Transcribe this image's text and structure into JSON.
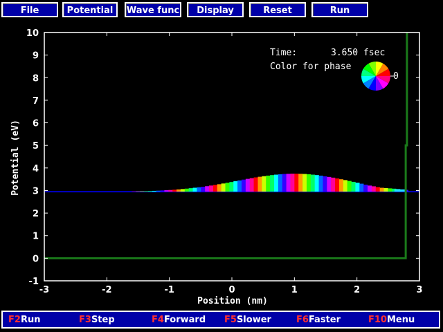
{
  "menu": [
    {
      "label": "File"
    },
    {
      "label": "Potential"
    },
    {
      "label": "Wave func"
    },
    {
      "label": "Display"
    },
    {
      "label": "Reset"
    },
    {
      "label": "Run"
    }
  ],
  "annotation": {
    "time_label": "Time:",
    "time_value": "3.650 fsec",
    "color_label": "Color for phase",
    "phase_zero": "0"
  },
  "chart_data": {
    "type": "area",
    "title": "",
    "xlabel": "Position (nm)",
    "ylabel": "Potential (eV)",
    "xlim": [
      -3,
      3
    ],
    "ylim": [
      -1,
      10
    ],
    "xticks": [
      -3,
      -2,
      -1,
      0,
      1,
      2,
      3
    ],
    "yticks": [
      -1,
      0,
      1,
      2,
      3,
      4,
      5,
      6,
      7,
      8,
      9,
      10
    ],
    "grid": false,
    "colors": {
      "potential": "#1a7a1a",
      "baseline": "#0000cc",
      "axes": "#ffffff"
    },
    "series": [
      {
        "name": "potential",
        "x": [
          -3,
          2.78,
          2.78,
          2.8,
          2.8
        ],
        "y": [
          0,
          0,
          5,
          5,
          10
        ]
      },
      {
        "name": "wave-packet",
        "baseline": 2.95,
        "x": [
          -1.6,
          -1.4,
          -1.2,
          -1.0,
          -0.8,
          -0.6,
          -0.4,
          -0.2,
          0,
          0.2,
          0.4,
          0.6,
          0.8,
          1.0,
          1.2,
          1.4,
          1.6,
          1.8,
          2.0,
          2.2,
          2.4,
          2.6,
          2.78
        ],
        "y": [
          2.96,
          2.97,
          2.99,
          3.02,
          3.06,
          3.12,
          3.19,
          3.28,
          3.38,
          3.49,
          3.59,
          3.67,
          3.73,
          3.75,
          3.73,
          3.67,
          3.58,
          3.47,
          3.35,
          3.22,
          3.12,
          3.08,
          3.03
        ]
      }
    ]
  },
  "status": [
    {
      "key": "F2",
      "label": "Run"
    },
    {
      "key": "F3",
      "label": "Step"
    },
    {
      "key": "F4",
      "label": "Forward"
    },
    {
      "key": "F5",
      "label": "Slower"
    },
    {
      "key": "F6",
      "label": "Faster"
    },
    {
      "key": "F10",
      "label": "Menu"
    }
  ]
}
